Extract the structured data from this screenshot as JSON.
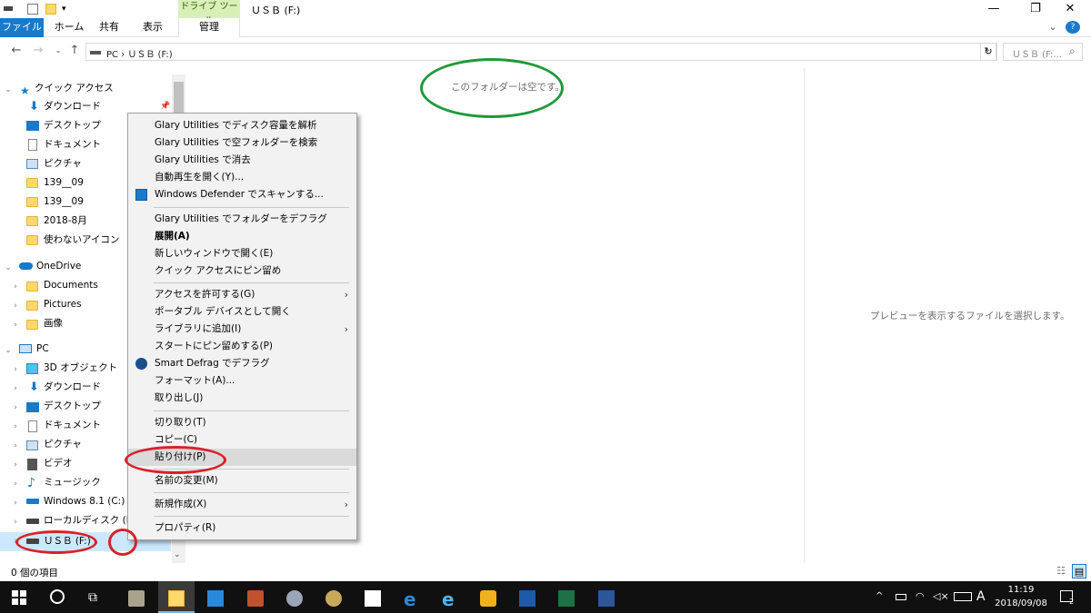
{
  "window": {
    "title": "ＵＳＢ (F:)",
    "drive_tools_label": "ドライブ ツール",
    "controls": {
      "minimize": "—",
      "maximize": "❐",
      "close": "✕"
    }
  },
  "ribbon": {
    "tabs": [
      "ファイル",
      "ホーム",
      "共有",
      "表示",
      "管理"
    ],
    "collapse": "⌄",
    "help": "?"
  },
  "address": {
    "path": "PC  ›  ＵＳＢ (F:)",
    "search_placeholder": "ＵＳＢ (F:...",
    "refresh": "↻"
  },
  "nav": {
    "quick_access": "クイック アクセス",
    "quick_items": [
      "ダウンロード",
      "デスクトップ",
      "ドキュメント",
      "ピクチャ",
      "139__09",
      "139__09",
      "2018-8月",
      "使わないアイコン"
    ],
    "onedrive": "OneDrive",
    "onedrive_items": [
      "Documents",
      "Pictures",
      "画像"
    ],
    "pc": "PC",
    "pc_items": [
      "3D オブジェクト",
      "ダウンロード",
      "デスクトップ",
      "ドキュメント",
      "ピクチャ",
      "ビデオ",
      "ミュージック",
      "Windows 8.1 (C:)",
      "ローカルディスク (D:)",
      "ＵＳＢ (F:)"
    ]
  },
  "main": {
    "empty_message": "このフォルダーは空です。",
    "preview_message": "プレビューを表示するファイルを選択します。"
  },
  "context_menu": {
    "groups": [
      [
        "Glary Utilities でディスク容量を解析",
        "Glary Utilities で空フォルダーを検索",
        "Glary Utilities で消去",
        "自動再生を開く(Y)...",
        "Windows Defender でスキャンする..."
      ],
      [
        "Glary Utilities でフォルダーをデフラグ",
        "展開(A)",
        "新しいウィンドウで開く(E)",
        "クイック アクセスにピン留め"
      ],
      [
        "アクセスを許可する(G)",
        "ポータブル デバイスとして開く",
        "ライブラリに追加(I)",
        "スタートにピン留めする(P)",
        "Smart Defrag でデフラグ",
        "フォーマット(A)...",
        "取り出し(J)"
      ],
      [
        "切り取り(T)",
        "コピー(C)",
        "貼り付け(P)"
      ],
      [
        "名前の変更(M)"
      ],
      [
        "新規作成(X)"
      ],
      [
        "プロパティ(R)"
      ]
    ],
    "highlighted": "貼り付け(P)"
  },
  "status": {
    "items_count": "0 個の項目"
  },
  "taskbar": {
    "ime": "A",
    "time": "11:19",
    "date": "2018/09/08",
    "notifications": "2"
  },
  "colors": {
    "accent": "#1979ca",
    "drive_tools_bg": "#d8f0b8",
    "selection": "#cce8ff",
    "annotation_green": "#1e9a3a",
    "annotation_red": "#d8222a"
  }
}
